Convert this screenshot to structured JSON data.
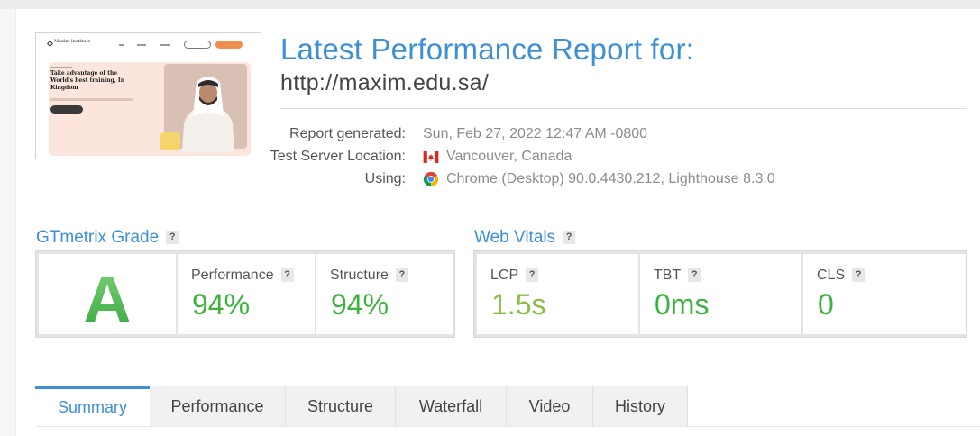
{
  "report": {
    "title": "Latest Performance Report for:",
    "url": "http://maxim.edu.sa/"
  },
  "thumbnail": {
    "logo": "Maxim Institute",
    "hero_title": "Take advantage of the World's best training, In Kingdom"
  },
  "meta": {
    "generated_label": "Report generated:",
    "generated_value": "Sun, Feb 27, 2022 12:47 AM -0800",
    "location_label": "Test Server Location:",
    "location_value": "Vancouver, Canada",
    "location_icon": "canada-flag-icon",
    "using_label": "Using:",
    "using_value": "Chrome (Desktop) 90.0.4430.212, Lighthouse 8.3.0",
    "using_icon": "chrome-icon"
  },
  "grade": {
    "title": "GTmetrix Grade",
    "help": "?",
    "letter": "A",
    "performance_label": "Performance",
    "performance_value": "94%",
    "structure_label": "Structure",
    "structure_value": "94%"
  },
  "vitals": {
    "title": "Web Vitals",
    "help": "?",
    "lcp_label": "LCP",
    "lcp_value": "1.5s",
    "tbt_label": "TBT",
    "tbt_value": "0ms",
    "cls_label": "CLS",
    "cls_value": "0"
  },
  "tabs": [
    "Summary",
    "Performance",
    "Structure",
    "Waterfall",
    "Video",
    "History"
  ],
  "active_tab": "Summary",
  "colors": {
    "accent": "#3d8fd6",
    "good_green": "#3db33d",
    "lcp_green": "#8cbc46"
  }
}
